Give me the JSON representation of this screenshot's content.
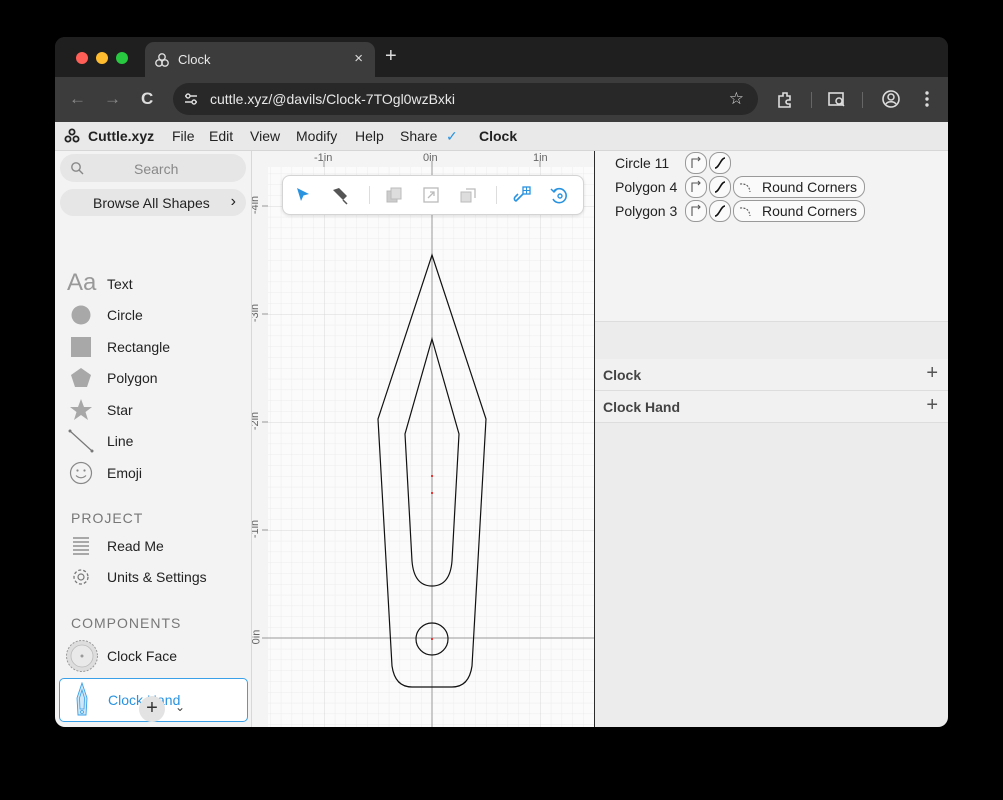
{
  "browser": {
    "tab_title": "Clock",
    "tab_close": "×",
    "new_tab": "+",
    "url": "cuttle.xyz/@davils/Clock-7TOgl0wzBxki",
    "back": "←",
    "forward": "→",
    "reload": "C",
    "star": "☆"
  },
  "menubar": {
    "brand": "Cuttle.xyz",
    "items": [
      "File",
      "Edit",
      "View",
      "Modify",
      "Help",
      "Share"
    ],
    "share_check": "✓",
    "doc_title": "Clock"
  },
  "sidebar": {
    "search_placeholder": "Search",
    "browse_label": "Browse All Shapes",
    "browse_chevron": "›",
    "shapes": [
      {
        "label": "Text",
        "icon": "text-icon"
      },
      {
        "label": "Circle",
        "icon": "circle-icon"
      },
      {
        "label": "Rectangle",
        "icon": "rectangle-icon"
      },
      {
        "label": "Polygon",
        "icon": "polygon-icon"
      },
      {
        "label": "Star",
        "icon": "star-icon"
      },
      {
        "label": "Line",
        "icon": "line-icon"
      },
      {
        "label": "Emoji",
        "icon": "emoji-icon"
      }
    ],
    "text_icon_glyph": "Aa",
    "project_title": "PROJECT",
    "project_items": [
      {
        "label": "Read Me",
        "icon": "readme-icon"
      },
      {
        "label": "Units & Settings",
        "icon": "gear-icon"
      }
    ],
    "components_title": "COMPONENTS",
    "components": [
      {
        "label": "Clock Face",
        "icon": "clock-face-thumbnail-icon"
      },
      {
        "label": "Clock Hand",
        "icon": "clock-hand-thumbnail-icon",
        "selected": true
      }
    ],
    "add_component": "+",
    "add_component_chevron": "⌄"
  },
  "canvas": {
    "ruler_x_labels": [
      "-1in",
      "0in",
      "1in"
    ],
    "ruler_y_labels": [
      "-4in",
      "-3in",
      "-2in",
      "-1in",
      "0in"
    ]
  },
  "right_panel": {
    "modifiers": [
      {
        "name": "Circle 11",
        "extra": ""
      },
      {
        "name": "Polygon 4",
        "extra": "Round Corners"
      },
      {
        "name": "Polygon 3",
        "extra": "Round Corners"
      }
    ],
    "groups": [
      {
        "name": "Clock",
        "plus": "+"
      },
      {
        "name": "Clock Hand",
        "plus": "+"
      }
    ]
  },
  "colors": {
    "accent": "#2a93e0",
    "selected_border": "#3aa0e8"
  }
}
